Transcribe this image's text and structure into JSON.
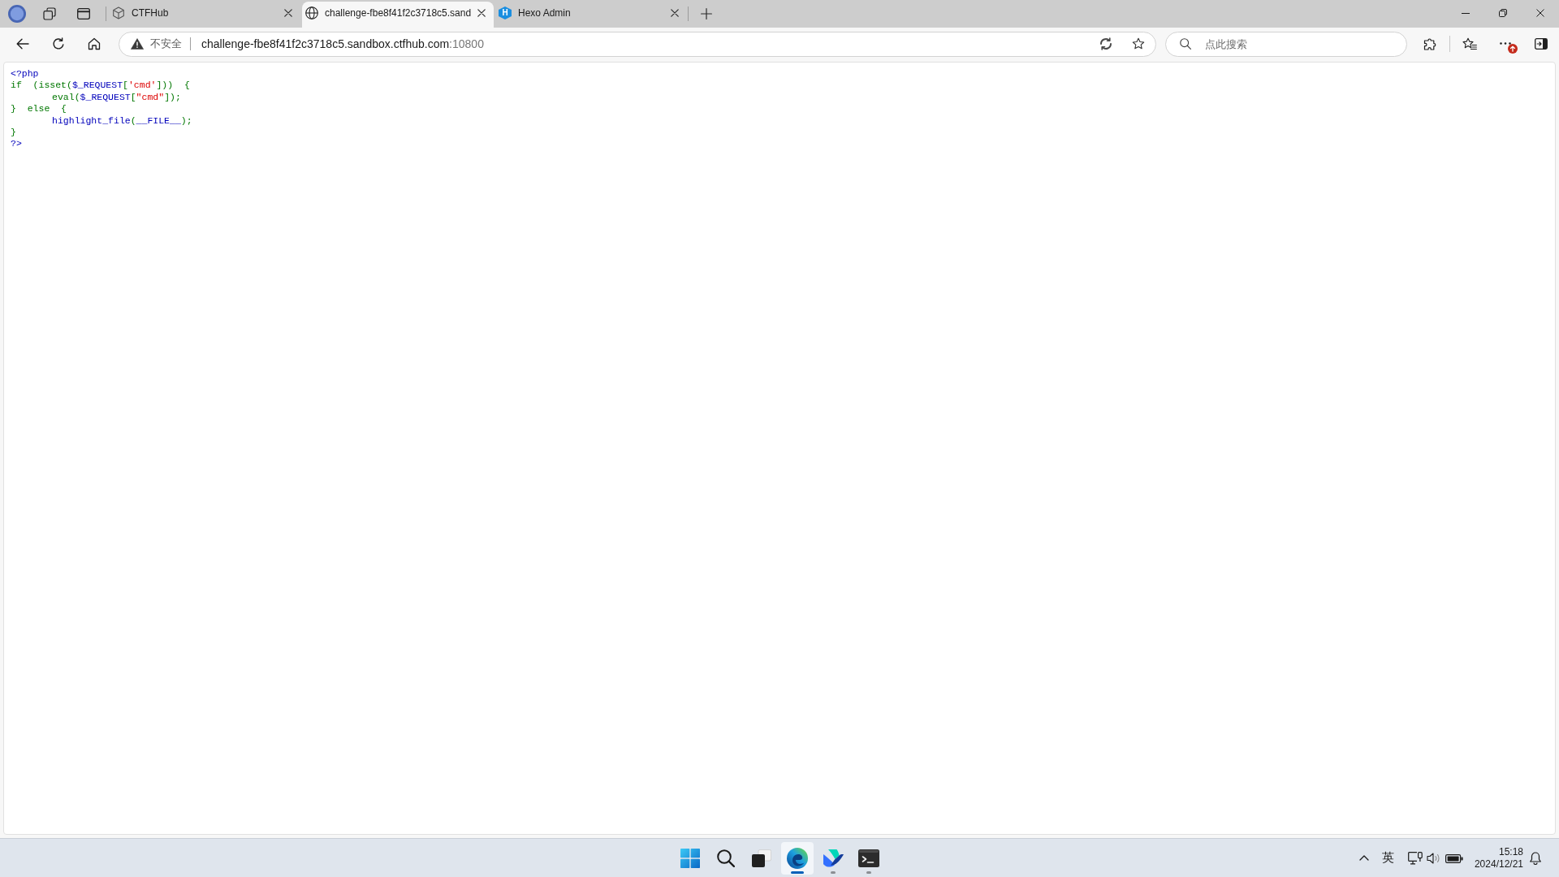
{
  "browser": {
    "tabs": [
      {
        "title": "CTFHub",
        "selected": false
      },
      {
        "title": "challenge-fbe8f41f2c3718c5.sand",
        "selected": true
      },
      {
        "title": "Hexo Admin",
        "selected": false,
        "favicon_text": "H"
      }
    ],
    "address_bar": {
      "security_label": "不安全",
      "host": "challenge-fbe8f41f2c3718c5.sandbox.ctfhub.com",
      "port": ":10800"
    },
    "search": {
      "placeholder": "点此搜索"
    }
  },
  "page": {
    "code_lines": [
      {
        "tokens": [
          {
            "kind": "default",
            "text": "<?php"
          }
        ]
      },
      {
        "tokens": [
          {
            "kind": "keyword",
            "text": "if  (isset("
          },
          {
            "kind": "default",
            "text": "$_REQUEST"
          },
          {
            "kind": "keyword",
            "text": "["
          },
          {
            "kind": "string",
            "text": "'cmd'"
          },
          {
            "kind": "keyword",
            "text": "]))  {"
          }
        ],
        "children": [
          {
            "tokens": [
              {
                "kind": "keyword",
                "text": "eval("
              },
              {
                "kind": "default",
                "text": "$_REQUEST"
              },
              {
                "kind": "keyword",
                "text": "["
              },
              {
                "kind": "string",
                "text": "\"cmd\""
              },
              {
                "kind": "keyword",
                "text": "]);"
              }
            ]
          }
        ]
      },
      {
        "tokens": [
          {
            "kind": "keyword",
            "text": "}  else  {"
          }
        ],
        "children": [
          {
            "tokens": [
              {
                "kind": "default",
                "text": "highlight_file"
              },
              {
                "kind": "keyword",
                "text": "("
              },
              {
                "kind": "default",
                "text": "__FILE__"
              },
              {
                "kind": "keyword",
                "text": ");"
              }
            ]
          }
        ]
      },
      {
        "tokens": [
          {
            "kind": "keyword",
            "text": "}"
          }
        ]
      },
      {
        "tokens": [
          {
            "kind": "default",
            "text": "?>"
          }
        ]
      }
    ]
  },
  "taskbar": {
    "apps": [
      {
        "running": false,
        "selected": false
      },
      {
        "running": false,
        "selected": false
      },
      {
        "running": false,
        "selected": false
      },
      {
        "running": true,
        "selected": true
      },
      {
        "running": true,
        "selected": false
      },
      {
        "running": true,
        "selected": false
      }
    ],
    "tray": {
      "input_method": "英",
      "time": "15:18",
      "date": "2024/12/21"
    }
  }
}
